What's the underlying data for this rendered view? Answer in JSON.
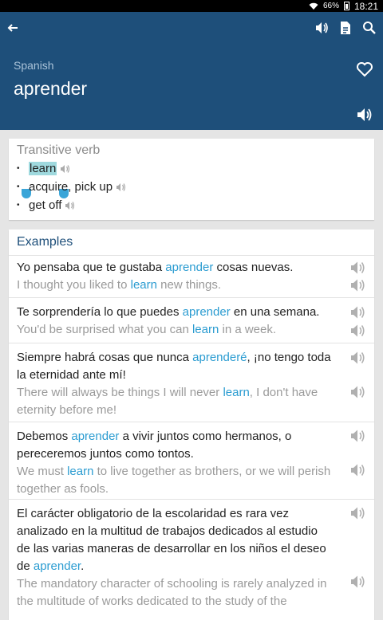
{
  "status": {
    "battery": "66%",
    "time": "18:21"
  },
  "header": {
    "language": "Spanish",
    "word": "aprender"
  },
  "definition": {
    "part_of_speech": "Transitive verb",
    "translations": [
      "learn",
      "acquire, pick up",
      "get off"
    ]
  },
  "examples": {
    "title": "Examples",
    "items": [
      {
        "es": {
          "before": "Yo pensaba que te gustaba ",
          "hl": "aprender",
          "after": " cosas nuevas."
        },
        "en": {
          "before": "I thought you liked to ",
          "hl": "learn",
          "after": " new things."
        }
      },
      {
        "es": {
          "before": "Te sorprendería lo que puedes ",
          "hl": "aprender",
          "after": " en una semana."
        },
        "en": {
          "before": "You'd be surprised what you can ",
          "hl": "learn",
          "after": " in a week."
        }
      },
      {
        "es": {
          "before": "Siempre habrá cosas que nunca ",
          "hl": "aprenderé",
          "after": ", ¡no tengo toda la eternidad ante mí!"
        },
        "en": {
          "before": "There will always be things I will never ",
          "hl": "learn",
          "after": ", I don't have eternity before me!"
        }
      },
      {
        "es": {
          "before": "Debemos ",
          "hl": "aprender",
          "after": " a vivir juntos como hermanos, o pereceremos juntos como tontos."
        },
        "en": {
          "before": "We must ",
          "hl": "learn",
          "after": " to live together as brothers, or we will perish together as fools."
        }
      },
      {
        "es": {
          "before": "El carácter obligatorio de la escolaridad es rara vez analizado en la multitud de trabajos dedicados al estudio de las varias maneras de desarrollar en los niños el deseo de ",
          "hl": "aprender",
          "after": "."
        },
        "en": {
          "before": "The mandatory character of schooling is rarely analyzed in the multitude of works dedicated to the study of the",
          "hl": "",
          "after": ""
        }
      }
    ]
  },
  "colors": {
    "appbar": "#1e4f7a",
    "highlight": "#2b9cd1",
    "selection": "#9fd9de"
  },
  "icons": [
    "back-arrow-icon",
    "speaker-icon",
    "document-icon",
    "search-icon",
    "heart-icon"
  ]
}
